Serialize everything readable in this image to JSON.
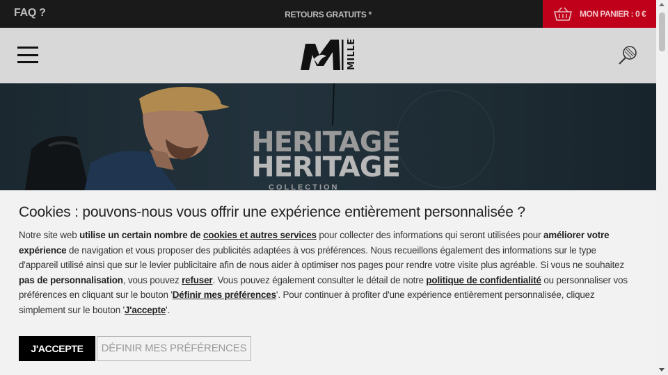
{
  "topbar": {
    "faq": "FAQ ?",
    "retours": "RETOURS GRATUITS *",
    "cart_label": "MON PANIER : 0 €",
    "cart_icon": "basket-icon"
  },
  "header": {
    "menu_icon": "hamburger-menu-icon",
    "logo_text": "MILLET",
    "search_icon": "search-icon"
  },
  "hero": {
    "title_line1": "HERITAGE",
    "title_line2": "HERITAGE",
    "subtitle": "COLLECTION"
  },
  "cookie": {
    "title": "Cookies : pouvons-nous vous offrir une expérience entièrement personnalisée ?",
    "p1": "Notre site web ",
    "b1": "utilise un certain nombre de ",
    "link_cookies": "cookies et autres services",
    "p2": " pour collecter des informations qui seront utilisées pour ",
    "b2": "améliorer votre expérience",
    "p3": " de navigation et vous proposer des publicités adaptées à vos préférences. Nous recueillons également des informations sur le type d'appareil utilisé ainsi que sur le levier publicitaire afin de nous aider à optimiser nos pages pour rendre votre visite plus agréable. Si vous ne souhaitez ",
    "b3": "pas de personnalisation",
    "p4": ", vous pouvez ",
    "link_refuser": "refuser",
    "p5": ". Vous pouvez également consulter le détail de notre ",
    "link_politique": "politique de confidentialité",
    "p6": " ou personnaliser vos préférences en cliquant sur le bouton '",
    "link_definir": "Définir mes préférences",
    "p7": "'. Pour continuer à profiter d'une expérience entièrement personnalisée, cliquez simplement sur le bouton '",
    "link_jaccepte": "J'accepte",
    "p8": "'.",
    "accept_button": "J'ACCEPTE",
    "prefs_button": "DÉFINIR MES PRÉFÉRENCES"
  },
  "colors": {
    "topbar_bg": "#1a1a1a",
    "cart_bg": "#c0001a",
    "header_bg": "#d8d8d8",
    "cookie_bg": "#f2f2f2"
  }
}
